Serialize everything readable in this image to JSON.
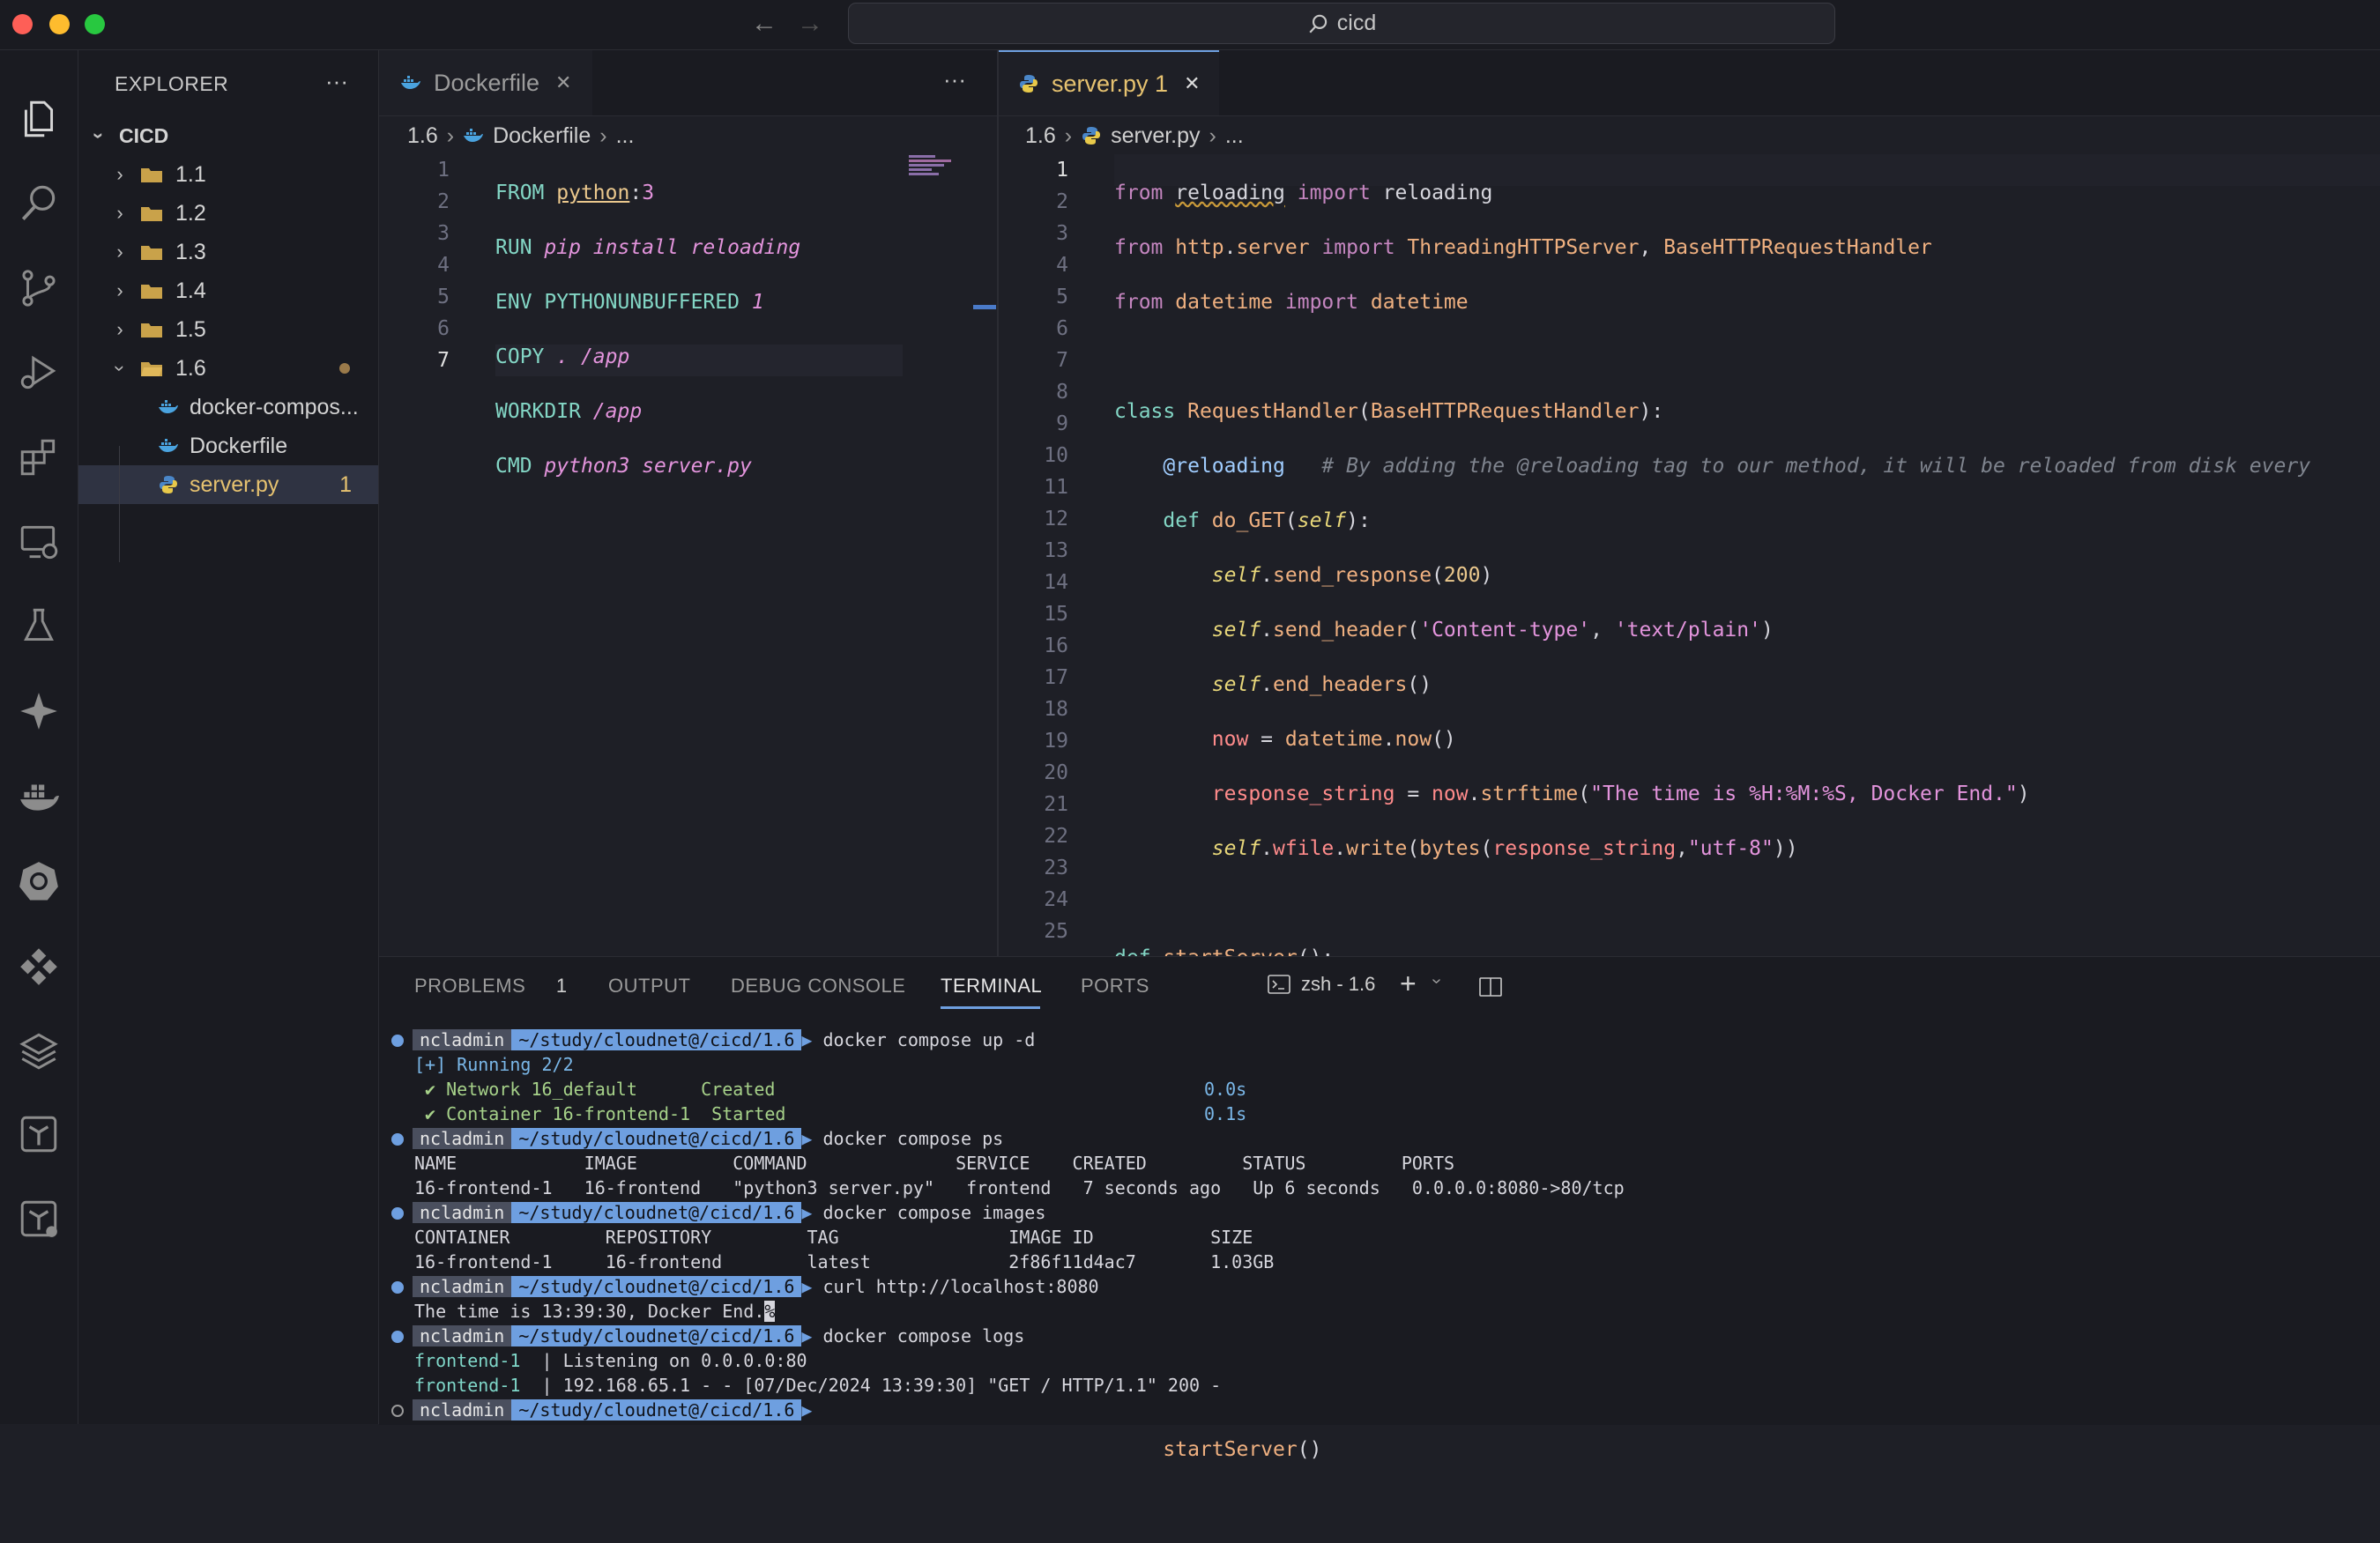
{
  "window": {
    "search": "cicd",
    "back": "←",
    "forward": "→"
  },
  "colors": {
    "accent": "#6e9fe0",
    "background": "#1e1f26",
    "sidebar": "#1a1b21"
  },
  "sidebar": {
    "title": "EXPLORER",
    "more": "···",
    "root": "CICD",
    "items": [
      {
        "label": "1.1",
        "type": "folder"
      },
      {
        "label": "1.2",
        "type": "folder"
      },
      {
        "label": "1.3",
        "type": "folder"
      },
      {
        "label": "1.4",
        "type": "folder"
      },
      {
        "label": "1.5",
        "type": "folder"
      },
      {
        "label": "1.6",
        "type": "folder-open"
      },
      {
        "label": "docker-compos...",
        "type": "docker-file"
      },
      {
        "label": "Dockerfile",
        "type": "docker-file"
      },
      {
        "label": "server.py",
        "type": "python-file",
        "badge": "1"
      }
    ]
  },
  "editor_left": {
    "tab": "Dockerfile",
    "close": "✕",
    "more": "···",
    "crumb_folder": "1.6",
    "crumb_file": "Dockerfile",
    "crumb_more": "...",
    "line_numbers": [
      "1",
      "2",
      "3",
      "4",
      "5",
      "6",
      "7"
    ]
  },
  "editor_right": {
    "tab": "server.py 1",
    "close": "✕",
    "crumb_folder": "1.6",
    "crumb_file": "server.py",
    "crumb_more": "...",
    "line_numbers": [
      "1",
      "2",
      "3",
      "4",
      "5",
      "6",
      "7",
      "8",
      "9",
      "10",
      "11",
      "12",
      "13",
      "14",
      "15",
      "16",
      "17",
      "18",
      "19",
      "20",
      "21",
      "22",
      "23",
      "24",
      "25"
    ]
  },
  "panel": {
    "tabs": {
      "problems": "PROBLEMS",
      "problems_count": "1",
      "output": "OUTPUT",
      "debug": "DEBUG CONSOLE",
      "terminal": "TERMINAL",
      "ports": "PORTS"
    },
    "shell": "zsh - 1.6",
    "prompt_user": "ncladmin",
    "prompt_path": "~/study/cloudnet@/cicd/1.6",
    "terminal": {
      "cmd1": "docker compose up -d",
      "running": "[+] Running 2/2",
      "net_name": " ✔ Network 16_default      ",
      "net_status": "Created",
      "net_time": "0.0s",
      "cont_name": " ✔ Container 16-frontend-1  ",
      "cont_status": "Started",
      "cont_time": "0.1s",
      "cmd2": "docker compose ps",
      "ps_header": "NAME            IMAGE         COMMAND              SERVICE    CREATED         STATUS         PORTS",
      "ps_row": "16-frontend-1   16-frontend   \"python3 server.py\"   frontend   7 seconds ago   Up 6 seconds   0.0.0.0:8080->80/tcp",
      "cmd3": "docker compose images",
      "img_header": "CONTAINER         REPOSITORY         TAG                IMAGE ID           SIZE",
      "img_row": "16-frontend-1     16-frontend        latest             2f86f11d4ac7       1.03GB",
      "cmd4": "curl http://localhost:8080",
      "curl_out": "The time is 13:39:30, Docker End.",
      "curl_mark": "%",
      "cmd5": "docker compose logs",
      "log1_svc": "frontend-1  ",
      "log1_text": "| Listening on 0.0.0.0:80",
      "log2_svc": "frontend-1  ",
      "log2_text": "| 192.168.65.1 - - [07/Dec/2024 13:39:30] \"GET / HTTP/1.1\" 200 -"
    }
  }
}
